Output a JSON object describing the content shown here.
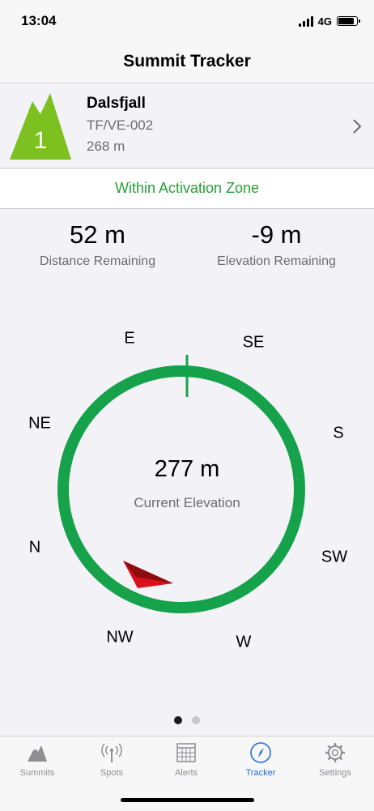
{
  "status": {
    "time": "13:04",
    "network": "4G"
  },
  "nav": {
    "title": "Summit Tracker"
  },
  "summit": {
    "badge_number": "1",
    "name": "Dalsfjall",
    "ref": "TF/VE-002",
    "height": "268 m",
    "badge_color": "#7cc11f"
  },
  "zone": {
    "text": "Within Activation Zone",
    "color": "#27a036"
  },
  "stats": {
    "distance_value": "52 m",
    "distance_label": "Distance Remaining",
    "elevation_value": "-9 m",
    "elevation_label": "Elevation Remaining"
  },
  "compass": {
    "directions": [
      "E",
      "SE",
      "S",
      "SW",
      "W",
      "NW",
      "N",
      "NE"
    ],
    "ring_color": "#15a24a",
    "pointer_color": "#d8101a",
    "current_value": "277 m",
    "current_label": "Current Elevation"
  },
  "pager": {
    "count": 2,
    "active": 0
  },
  "tabs": [
    {
      "label": "Summits",
      "icon": "mountain-icon"
    },
    {
      "label": "Spots",
      "icon": "antenna-icon"
    },
    {
      "label": "Alerts",
      "icon": "calendar-icon"
    },
    {
      "label": "Tracker",
      "icon": "compass-icon",
      "active": true
    },
    {
      "label": "Settings",
      "icon": "gear-icon"
    }
  ]
}
